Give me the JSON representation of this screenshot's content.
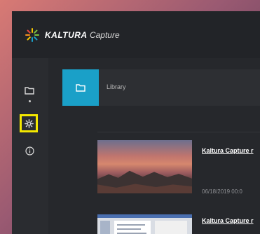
{
  "app": {
    "brand_primary": "KALTURA",
    "brand_secondary": "Capture",
    "accent_color": "#1aa0c8",
    "highlight_color": "#f4e800"
  },
  "sidebar": {
    "items": [
      {
        "name": "library",
        "icon": "folder-icon",
        "active": true
      },
      {
        "name": "settings",
        "icon": "gear-icon",
        "highlighted": true
      },
      {
        "name": "about",
        "icon": "info-icon"
      }
    ]
  },
  "library": {
    "title": "Library",
    "entries": [
      {
        "title": "Kaltura Capture r",
        "meta": "06/18/2019   00:0"
      },
      {
        "title": "Kaltura Capture r"
      }
    ]
  }
}
